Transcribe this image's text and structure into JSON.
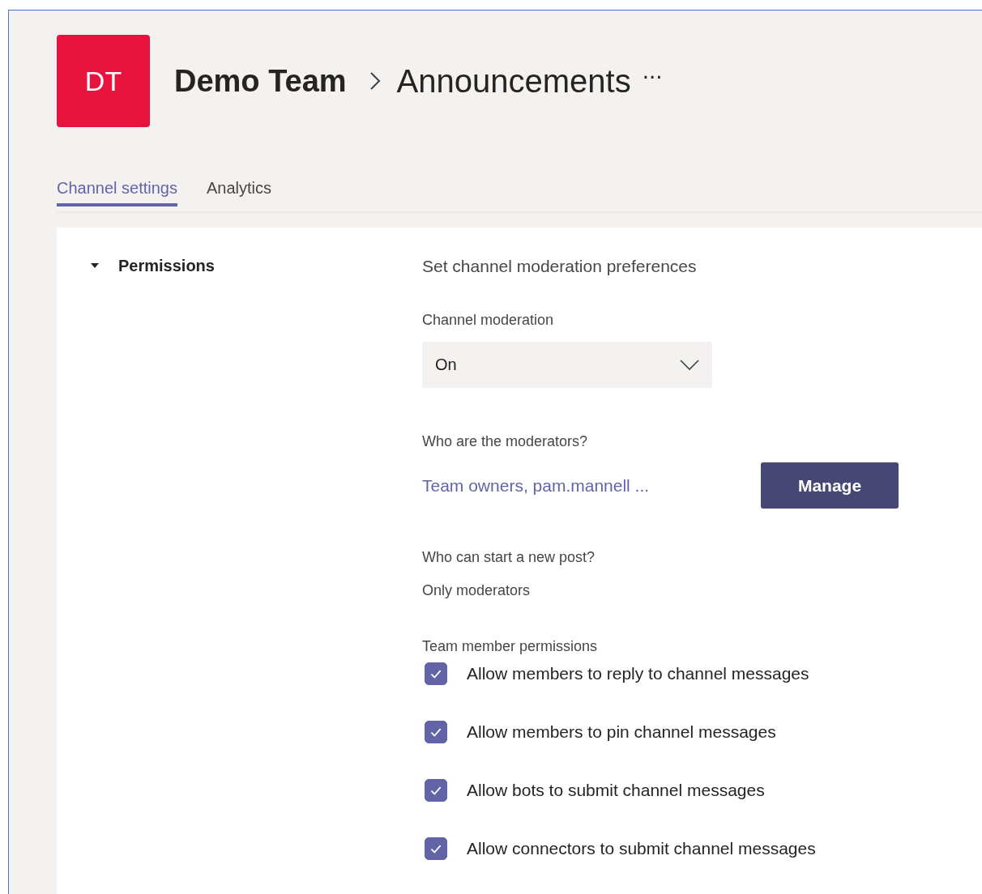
{
  "team": {
    "initials": "DT",
    "name": "Demo Team",
    "channel": "Announcements",
    "more": "···"
  },
  "tabs": [
    {
      "label": "Channel settings",
      "selected": true
    },
    {
      "label": "Analytics",
      "selected": false
    }
  ],
  "section": {
    "title": "Permissions",
    "expanded": true,
    "heading": "Set channel moderation preferences",
    "moderation": {
      "label": "Channel moderation",
      "value": "On"
    },
    "moderators": {
      "label": "Who are the moderators?",
      "link": "Team owners, pam.mannell ...",
      "button": "Manage"
    },
    "new_post": {
      "label": "Who can start a new post?",
      "value": "Only moderators"
    },
    "member_permissions": {
      "label": "Team member permissions",
      "options": [
        {
          "label": "Allow members to reply to channel messages",
          "checked": true
        },
        {
          "label": "Allow members to pin channel messages",
          "checked": true
        },
        {
          "label": "Allow bots to submit channel messages",
          "checked": true
        },
        {
          "label": "Allow connectors to submit channel messages",
          "checked": true
        }
      ]
    }
  }
}
